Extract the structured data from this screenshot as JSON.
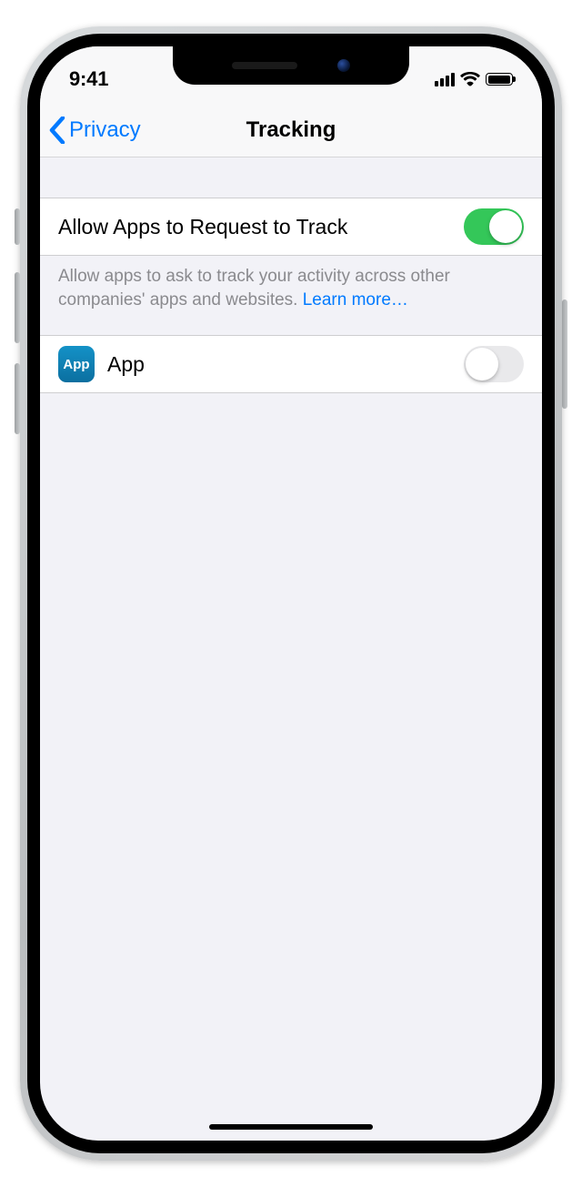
{
  "status": {
    "time": "9:41"
  },
  "nav": {
    "back_label": "Privacy",
    "title": "Tracking"
  },
  "section1": {
    "row": {
      "label": "Allow Apps to Request to Track",
      "toggle_on": true
    },
    "footer_text": "Allow apps to ask to track your activity across other companies' apps and websites. ",
    "learn_more": "Learn more…"
  },
  "apps": {
    "icon_text": "App",
    "name": "App",
    "toggle_on": false
  }
}
